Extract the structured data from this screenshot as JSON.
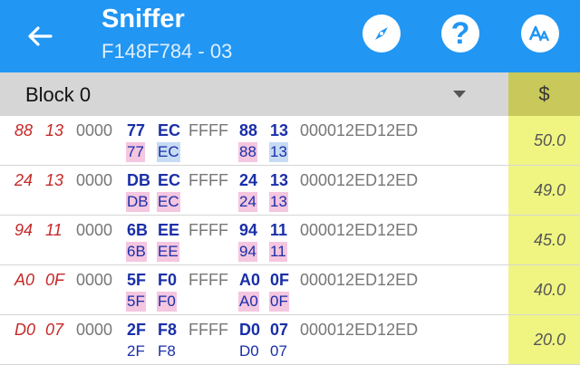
{
  "header": {
    "title": "Sniffer",
    "subtitle": "F148F784 - 03",
    "help_glyph": "?",
    "icons": [
      "back-arrow-icon",
      "compass-icon",
      "help-icon",
      "font-size-icon"
    ],
    "color": "#2196f3"
  },
  "block_selector": {
    "label": "Block 0",
    "price_header": "$"
  },
  "rows": [
    {
      "a": "88",
      "b": "13",
      "z": "0000",
      "c": "77",
      "d": "EC",
      "f": "FFFF",
      "g": "88",
      "h": "13",
      "id": "000012ED12ED",
      "c2": "77",
      "d2": "EC",
      "g2": "88",
      "h2": "13",
      "price": "50.0"
    },
    {
      "a": "24",
      "b": "13",
      "z": "0000",
      "c": "DB",
      "d": "EC",
      "f": "FFFF",
      "g": "24",
      "h": "13",
      "id": "000012ED12ED",
      "c2": "DB",
      "d2": "EC",
      "g2": "24",
      "h2": "13",
      "price": "49.0"
    },
    {
      "a": "94",
      "b": "11",
      "z": "0000",
      "c": "6B",
      "d": "EE",
      "f": "FFFF",
      "g": "94",
      "h": "11",
      "id": "000012ED12ED",
      "c2": "6B",
      "d2": "EE",
      "g2": "94",
      "h2": "11",
      "price": "45.0"
    },
    {
      "a": "A0",
      "b": "0F",
      "z": "0000",
      "c": "5F",
      "d": "F0",
      "f": "FFFF",
      "g": "A0",
      "h": "0F",
      "id": "000012ED12ED",
      "c2": "5F",
      "d2": "F0",
      "g2": "A0",
      "h2": "0F",
      "price": "40.0"
    },
    {
      "a": "D0",
      "b": "07",
      "z": "0000",
      "c": "2F",
      "d": "F8",
      "f": "FFFF",
      "g": "D0",
      "h": "07",
      "id": "000012ED12ED",
      "c2": "2F",
      "d2": "F8",
      "g2": "D0",
      "h2": "07",
      "price": "20.0"
    }
  ]
}
